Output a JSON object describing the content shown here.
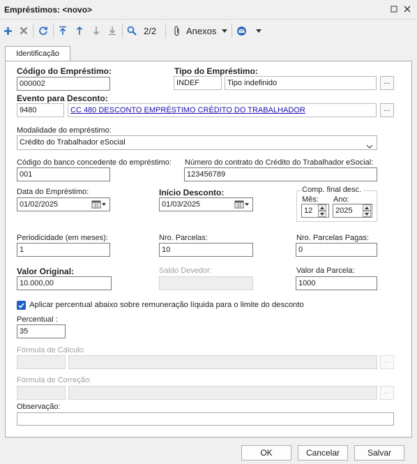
{
  "window": {
    "title": "Empréstimos: <novo>",
    "minimize_icon": "minimize-icon",
    "close_icon": "close-icon"
  },
  "toolbar": {
    "record_counter": "2/2",
    "attachments_label": "Anexos",
    "icons": [
      "plus-icon",
      "delete-icon",
      "refresh-icon",
      "first-record-icon",
      "previous-record-icon",
      "next-record-icon",
      "last-record-icon",
      "search-icon",
      "paperclip-icon",
      "email-icon"
    ]
  },
  "tabs": [
    {
      "label": "Identificação",
      "active": true
    }
  ],
  "form": {
    "codigo_emprestimo": {
      "label": "Código do Empréstimo:",
      "value": "000002"
    },
    "tipo_emprestimo": {
      "label": "Tipo do Empréstimo:",
      "code": "INDEF",
      "description": "Tipo indefinido"
    },
    "evento_desconto": {
      "label": "Evento para Desconto:",
      "code": "9480",
      "description": "CC 480 DESCONTO EMPRÉSTIMO CRÉDITO DO TRABALHADOR"
    },
    "modalidade": {
      "label": "Modalidade do empréstimo:",
      "selected": "Crédito do Trabalhador eSocial"
    },
    "codigo_banco": {
      "label": "Código do banco concedente do empréstimo:",
      "value": "001"
    },
    "numero_contrato": {
      "label": "Número do contrato do Crédito do Trabalhador eSocial:",
      "value": "123456789"
    },
    "data_emprestimo": {
      "label": "Data do Empréstimo:",
      "value": "01/02/2025"
    },
    "inicio_desconto": {
      "label": "Início Desconto:",
      "value": "01/03/2025"
    },
    "comp_final": {
      "legend": "Comp. final desc.",
      "mes_label": "Mês:",
      "mes_value": "12",
      "ano_label": "Ano:",
      "ano_value": "2025"
    },
    "periodicidade": {
      "label": "Periodicidade (em meses):",
      "value": "1"
    },
    "nro_parcelas": {
      "label": "Nro. Parcelas:",
      "value": "10"
    },
    "nro_parcelas_pagas": {
      "label": "Nro. Parcelas Pagas:",
      "value": "0"
    },
    "valor_original": {
      "label": "Valor Original:",
      "value": "10.000,00"
    },
    "saldo_devedor": {
      "label": "Saldo Devedor:",
      "value": ""
    },
    "valor_parcela": {
      "label": "Valor da Parcela:",
      "value": "1000"
    },
    "aplicar_percentual": {
      "label": "Aplicar percentual abaixo sobre remuneração líquida para o limite do desconto",
      "checked": true
    },
    "percentual": {
      "label": "Percentual :",
      "value": "35"
    },
    "formula_calculo": {
      "label": "Fórmula de Cálculo:",
      "code": "",
      "description": ""
    },
    "formula_correcao": {
      "label": "Fórmula de Correção:",
      "code": "",
      "description": ""
    },
    "observacao": {
      "label": "Observação:",
      "value": ""
    },
    "ellipsis": "..."
  },
  "buttons": {
    "ok": "OK",
    "cancel": "Cancelar",
    "save": "Salvar"
  },
  "colors": {
    "accent": "#1c5fc5",
    "link": "#1a0dab",
    "toolbar_icon": "#2f6fbf"
  }
}
